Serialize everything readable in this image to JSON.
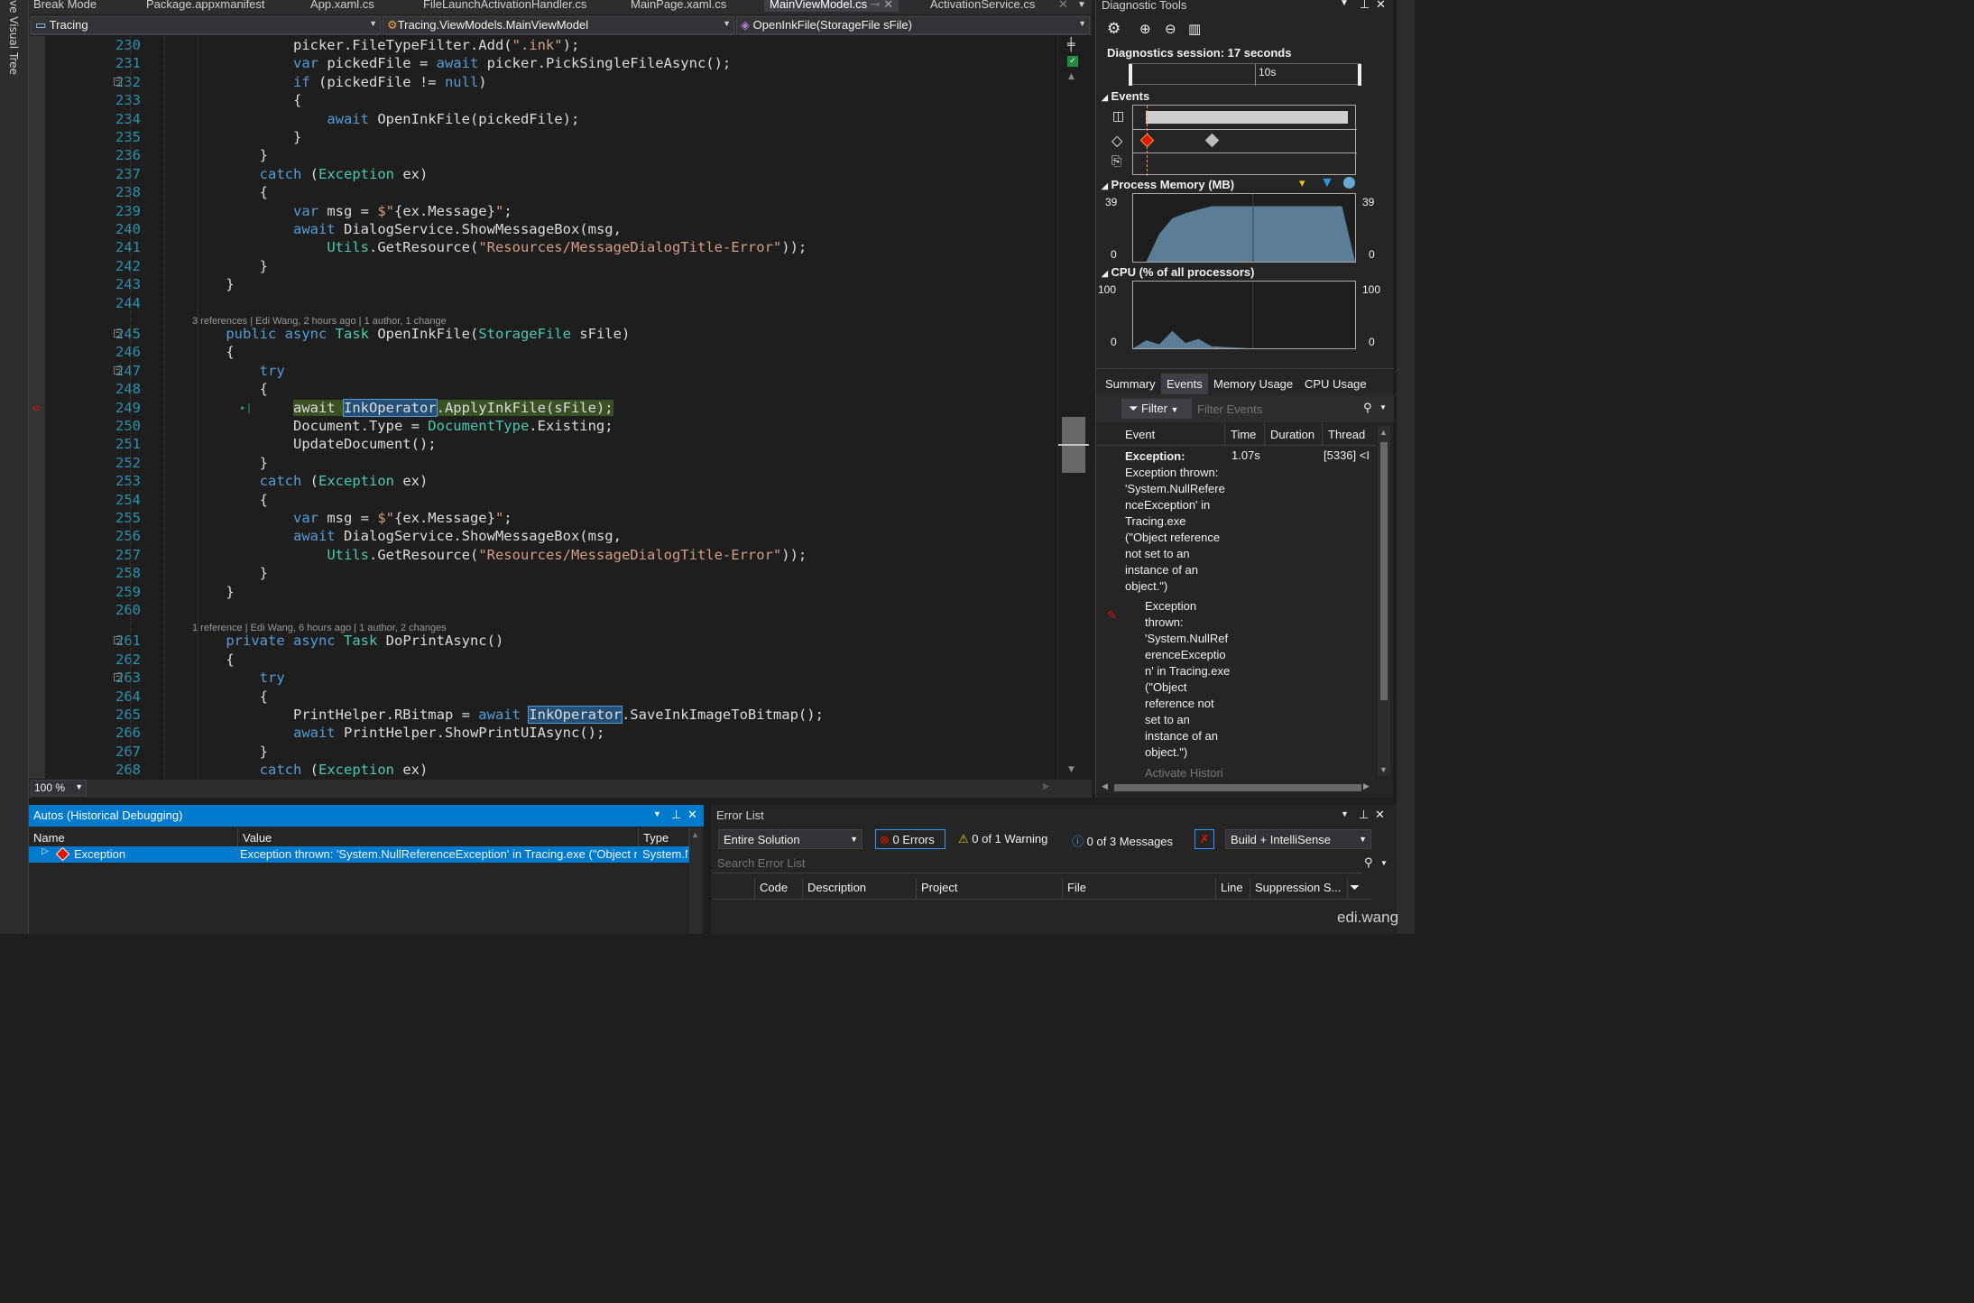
{
  "left_panel": {
    "label": "ve Visual Tree"
  },
  "tabs": [
    {
      "label": "Break Mode"
    },
    {
      "label": "Package.appxmanifest"
    },
    {
      "label": "App.xaml.cs"
    },
    {
      "label": "FileLaunchActivationHandler.cs"
    },
    {
      "label": "MainPage.xaml.cs"
    },
    {
      "label": "MainViewModel.cs"
    },
    {
      "label": "ActivationService.cs"
    }
  ],
  "nav": {
    "project": "Tracing",
    "class": "Tracing.ViewModels.MainViewModel",
    "member": "OpenInkFile(StorageFile sFile)"
  },
  "lens": [
    {
      "text": "3 references | Edi Wang, 2 hours ago | 1 author, 1 change"
    },
    {
      "text": "1 reference | Edi Wang, 6 hours ago | 1 author, 2 changes"
    }
  ],
  "code": [
    {
      "n": "230",
      "segs": [
        [
          "",
          "            picker.FileTypeFilter.Add("
        ],
        [
          "st",
          "\".ink\""
        ],
        [
          "",
          ");"
        ]
      ]
    },
    {
      "n": "231",
      "segs": [
        [
          "",
          "            "
        ],
        [
          "kw",
          "var"
        ],
        [
          "",
          " pickedFile = "
        ],
        [
          "kw",
          "await"
        ],
        [
          "",
          " picker.PickSingleFileAsync();"
        ]
      ]
    },
    {
      "n": "232",
      "segs": [
        [
          "",
          "            "
        ],
        [
          "kw",
          "if"
        ],
        [
          "",
          " (pickedFile != "
        ],
        [
          "kw",
          "null"
        ],
        [
          "",
          ")"
        ]
      ]
    },
    {
      "n": "233",
      "segs": [
        [
          "",
          "            {"
        ]
      ]
    },
    {
      "n": "234",
      "segs": [
        [
          "",
          "                "
        ],
        [
          "kw",
          "await"
        ],
        [
          "",
          " OpenInkFile(pickedFile);"
        ]
      ]
    },
    {
      "n": "235",
      "segs": [
        [
          "",
          "            }"
        ]
      ]
    },
    {
      "n": "236",
      "segs": [
        [
          "",
          "        }"
        ]
      ]
    },
    {
      "n": "237",
      "segs": [
        [
          "",
          "        "
        ],
        [
          "kw",
          "catch"
        ],
        [
          "",
          " ("
        ],
        [
          "ty",
          "Exception"
        ],
        [
          "",
          " ex)"
        ]
      ]
    },
    {
      "n": "238",
      "segs": [
        [
          "",
          "        {"
        ]
      ]
    },
    {
      "n": "239",
      "segs": [
        [
          "",
          "            "
        ],
        [
          "kw",
          "var"
        ],
        [
          "",
          " msg = "
        ],
        [
          "st",
          "$\""
        ],
        [
          "",
          "{ex.Message}"
        ],
        [
          "st",
          "\""
        ],
        [
          "",
          ";"
        ]
      ]
    },
    {
      "n": "240",
      "segs": [
        [
          "",
          "            "
        ],
        [
          "kw",
          "await"
        ],
        [
          "",
          " DialogService.ShowMessageBox(msg,"
        ]
      ]
    },
    {
      "n": "241",
      "segs": [
        [
          "",
          "                "
        ],
        [
          "ty",
          "Utils"
        ],
        [
          "",
          ".GetResource("
        ],
        [
          "st",
          "\"Resources/MessageDialogTitle-Error\""
        ],
        [
          "",
          "));"
        ]
      ]
    },
    {
      "n": "242",
      "segs": [
        [
          "",
          "        }"
        ]
      ]
    },
    {
      "n": "243",
      "segs": [
        [
          "",
          "    }"
        ]
      ]
    },
    {
      "n": "244",
      "segs": [
        [
          "",
          ""
        ]
      ]
    },
    {
      "n": "245",
      "segs": [
        [
          "",
          "    "
        ],
        [
          "kw",
          "public async"
        ],
        [
          "",
          " "
        ],
        [
          "ty",
          "Task"
        ],
        [
          "",
          " OpenInkFile("
        ],
        [
          "ty",
          "StorageFile"
        ],
        [
          "",
          " sFile)"
        ]
      ]
    },
    {
      "n": "246",
      "segs": [
        [
          "",
          "    {"
        ]
      ]
    },
    {
      "n": "247",
      "segs": [
        [
          "",
          "        "
        ],
        [
          "kw",
          "try"
        ]
      ]
    },
    {
      "n": "248",
      "segs": [
        [
          "",
          "        {"
        ]
      ]
    },
    {
      "n": "249",
      "segs": [
        [
          "",
          "            "
        ],
        [
          "hl",
          "await "
        ],
        [
          "hl2",
          "InkOperator"
        ],
        [
          "hl",
          ".ApplyInkFile(sFile);"
        ]
      ]
    },
    {
      "n": "250",
      "segs": [
        [
          "",
          "            Document.Type = "
        ],
        [
          "ty",
          "DocumentType"
        ],
        [
          "",
          ".Existing;"
        ]
      ]
    },
    {
      "n": "251",
      "segs": [
        [
          "",
          "            UpdateDocument();"
        ]
      ]
    },
    {
      "n": "252",
      "segs": [
        [
          "",
          "        }"
        ]
      ]
    },
    {
      "n": "253",
      "segs": [
        [
          "",
          "        "
        ],
        [
          "kw",
          "catch"
        ],
        [
          "",
          " ("
        ],
        [
          "ty",
          "Exception"
        ],
        [
          "",
          " ex)"
        ]
      ]
    },
    {
      "n": "254",
      "segs": [
        [
          "",
          "        {"
        ]
      ]
    },
    {
      "n": "255",
      "segs": [
        [
          "",
          "            "
        ],
        [
          "kw",
          "var"
        ],
        [
          "",
          " msg = "
        ],
        [
          "st",
          "$\""
        ],
        [
          "",
          "{ex.Message}"
        ],
        [
          "st",
          "\""
        ],
        [
          "",
          ";"
        ]
      ]
    },
    {
      "n": "256",
      "segs": [
        [
          "",
          "            "
        ],
        [
          "kw",
          "await"
        ],
        [
          "",
          " DialogService.ShowMessageBox(msg,"
        ]
      ]
    },
    {
      "n": "257",
      "segs": [
        [
          "",
          "                "
        ],
        [
          "ty",
          "Utils"
        ],
        [
          "",
          ".GetResource("
        ],
        [
          "st",
          "\"Resources/MessageDialogTitle-Error\""
        ],
        [
          "",
          "));"
        ]
      ]
    },
    {
      "n": "258",
      "segs": [
        [
          "",
          "        }"
        ]
      ]
    },
    {
      "n": "259",
      "segs": [
        [
          "",
          "    }"
        ]
      ]
    },
    {
      "n": "260",
      "segs": [
        [
          "",
          ""
        ]
      ]
    },
    {
      "n": "261",
      "segs": [
        [
          "",
          "    "
        ],
        [
          "kw",
          "private async"
        ],
        [
          "",
          " "
        ],
        [
          "ty",
          "Task"
        ],
        [
          "",
          " DoPrintAsync()"
        ]
      ]
    },
    {
      "n": "262",
      "segs": [
        [
          "",
          "    {"
        ]
      ]
    },
    {
      "n": "263",
      "segs": [
        [
          "",
          "        "
        ],
        [
          "kw",
          "try"
        ]
      ]
    },
    {
      "n": "264",
      "segs": [
        [
          "",
          "        {"
        ]
      ]
    },
    {
      "n": "265",
      "segs": [
        [
          "",
          "            PrintHelper.RBitmap = "
        ],
        [
          "kw",
          "await"
        ],
        [
          "",
          " "
        ],
        [
          "hl2",
          "InkOperator"
        ],
        [
          "",
          ".SaveInkImageToBitmap();"
        ]
      ]
    },
    {
      "n": "266",
      "segs": [
        [
          "",
          "            "
        ],
        [
          "kw",
          "await"
        ],
        [
          "",
          " PrintHelper.ShowPrintUIAsync();"
        ]
      ]
    },
    {
      "n": "267",
      "segs": [
        [
          "",
          "        }"
        ]
      ]
    },
    {
      "n": "268",
      "segs": [
        [
          "",
          "        "
        ],
        [
          "kw",
          "catch"
        ],
        [
          "",
          " ("
        ],
        [
          "ty",
          "Exception"
        ],
        [
          "",
          " ex)"
        ]
      ]
    }
  ],
  "editor": {
    "zoom": "100 %"
  },
  "diagnostic": {
    "title": "Diagnostic Tools",
    "session": "Diagnostics session: 17 seconds",
    "time_tick": "10s",
    "events_label": "Events",
    "memory_label": "Process Memory (MB)",
    "memory_max": "39",
    "memory_min": "0",
    "cpu_label": "CPU (% of all processors)",
    "cpu_max": "100",
    "cpu_min": "0",
    "tabs": [
      "Summary",
      "Events",
      "Memory Usage",
      "CPU Usage"
    ],
    "filter_label": "Filter",
    "filter_placeholder": "Filter Events",
    "columns": [
      "Event",
      "Time",
      "Duration",
      "Thread"
    ],
    "event1": {
      "title": "Exception:",
      "lines": [
        "Exception thrown:",
        "'System.NullRefere",
        "nceException' in",
        "Tracing.exe",
        "(\"Object reference",
        "not set to an",
        "instance of an",
        "object.\")"
      ],
      "time": "1.07s",
      "thread": "[5336] <I"
    },
    "event2": {
      "lines": [
        "Exception",
        "thrown:",
        "'System.NullRef",
        "erenceExceptio",
        "n' in Tracing.exe",
        "(\"Object",
        "reference not",
        "set to an",
        "instance of an",
        "object.\")"
      ]
    },
    "event3": "Activate Histori"
  },
  "autos": {
    "title": "Autos (Historical Debugging)",
    "columns": [
      "Name",
      "Value",
      "Type"
    ],
    "row": {
      "name": "Exception",
      "value": "Exception thrown: 'System.NullReferenceException' in Tracing.exe (\"Object refe",
      "type": "System.N"
    }
  },
  "errlist": {
    "title": "Error List",
    "scope": "Entire Solution",
    "errors": "0 Errors",
    "warnings": "0 of 1 Warning",
    "messages": "0 of 3 Messages",
    "build": "Build + IntelliSense",
    "search_placeholder": "Search Error List",
    "columns": [
      "Code",
      "Description",
      "Project",
      "File",
      "Line",
      "Suppression S..."
    ]
  },
  "watermark": "edi.wang",
  "colors": {
    "accent": "#007acc",
    "exception": "#e51400",
    "memory_fill": "#5b7e96"
  },
  "memory_series": [
    0,
    0,
    16,
    25,
    28,
    30,
    32,
    32,
    32,
    32,
    32,
    32,
    32,
    32,
    32,
    32,
    32,
    0
  ],
  "cpu_series": [
    0,
    12,
    6,
    26,
    8,
    14,
    3,
    2,
    1,
    0,
    0,
    0,
    0,
    0,
    0,
    0,
    0,
    0
  ]
}
